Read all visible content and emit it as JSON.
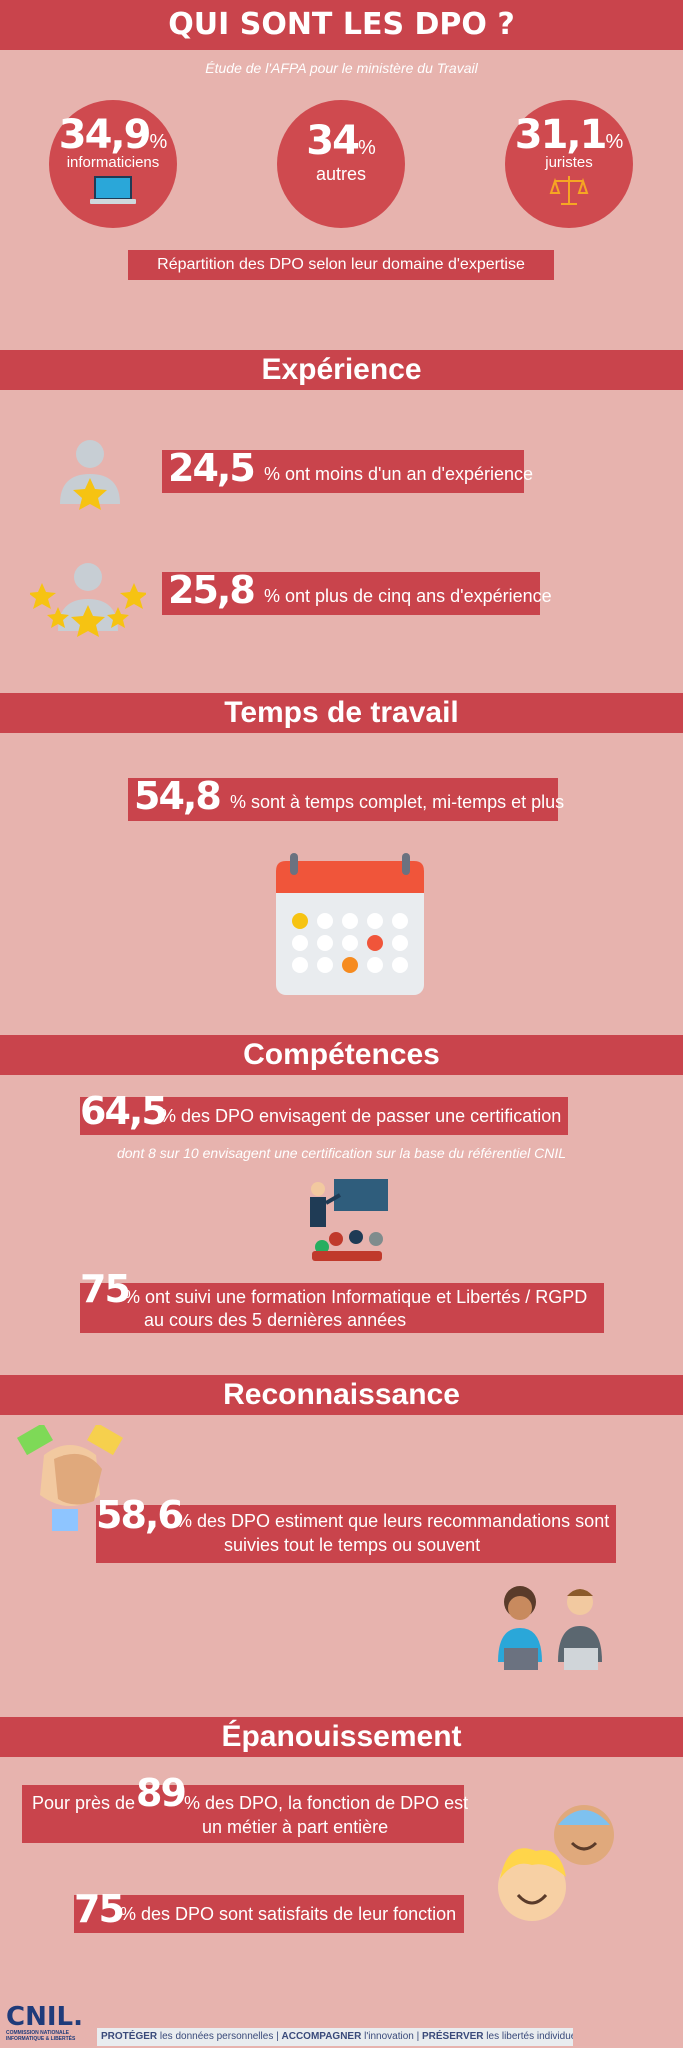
{
  "header": {
    "title": "QUI SONT LES DPO ?",
    "subtitle": "Étude de l'AFPA pour le ministère du Travail"
  },
  "domains": {
    "items": [
      {
        "value": "34,9",
        "unit": "%",
        "label": "informaticiens",
        "icon": "laptop-icon"
      },
      {
        "value": "34",
        "unit": "%",
        "label": "autres"
      },
      {
        "value": "31,1",
        "unit": "%",
        "label": "juristes",
        "icon": "scales-icon"
      }
    ],
    "caption": "Répartition des DPO selon leur domaine d'expertise"
  },
  "experience": {
    "title": "Expérience",
    "rows": [
      {
        "value": "24,5",
        "text": "% ont moins d'un an d'expérience",
        "icon": "person-one-star-icon"
      },
      {
        "value": "25,8",
        "text": "% ont plus de cinq ans d'expérience",
        "icon": "person-many-stars-icon"
      }
    ]
  },
  "work_time": {
    "title": "Temps de travail",
    "value": "54,8",
    "text": "% sont à temps complet, mi-temps et plus",
    "icon": "calendar-icon"
  },
  "skills": {
    "title": "Compétences",
    "cert_value": "64,5",
    "cert_text": "% des DPO envisagent de passer une certification",
    "cert_note": "dont 8  sur 10 envisagent une certification sur la base du référentiel CNIL",
    "training_value": "75",
    "training_text_1": "% ont suivi une formation Informatique et Libertés / RGPD",
    "training_text_2": "au cours des 5 dernières années",
    "icon": "classroom-icon"
  },
  "recognition": {
    "title": "Reconnaissance",
    "value": "58,6",
    "text_1": "% des DPO estiment que leurs recommandations sont",
    "text_2": "suivies tout le temps ou souvent",
    "icons": [
      "hands-together-icon",
      "people-laptops-icon"
    ]
  },
  "fulfilment": {
    "title": "Épanouissement",
    "prefix": "Pour près de",
    "value": "89",
    "text_1": "% des DPO, la fonction de DPO est",
    "text_2": "un métier à part entière",
    "sat_value": "75",
    "sat_text": "% des DPO sont satisfaits de leur fonction",
    "icon": "smiling-faces-icon"
  },
  "footer": {
    "logo": "CNIL.",
    "logo_sub_1": "COMMISSION NATIONALE",
    "logo_sub_2": "INFORMATIQUE & LIBERTÉS",
    "tagline": [
      {
        "strong": "PROTÉGER",
        "rest": " les données personnelles"
      },
      {
        "strong": "ACCOMPAGNER",
        "rest": " l'innovation"
      },
      {
        "strong": "PRÉSERVER",
        "rest": " les libertés individuelles"
      }
    ],
    "separator": "|"
  },
  "colors": {
    "background": "#e7b3ae",
    "band": "#c9444c",
    "circle": "#cf4a4f",
    "calendar_header": "#f0553a",
    "star": "#f6c312"
  }
}
